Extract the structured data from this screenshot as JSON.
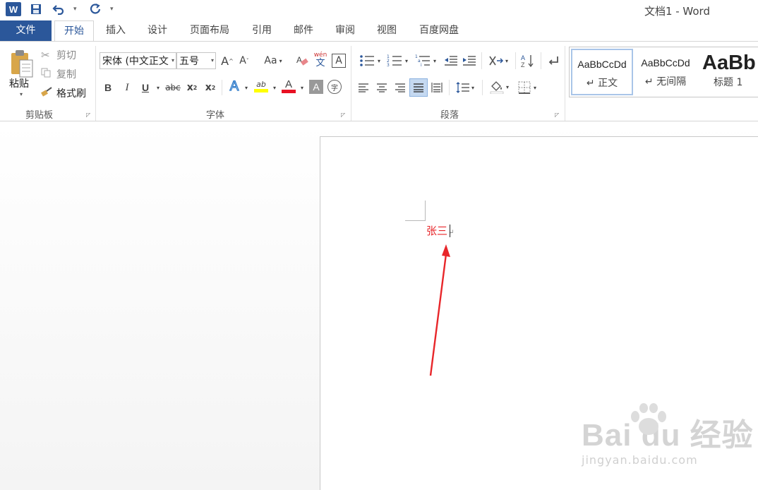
{
  "window": {
    "title": "文档1 - Word"
  },
  "qat": {
    "logo_letter": "W",
    "save_icon": "save-icon",
    "undo_icon": "undo-icon",
    "redo_icon": "redo-icon",
    "customize_icon": "customize-qat-icon"
  },
  "tabs": [
    {
      "label": "文件"
    },
    {
      "label": "开始"
    },
    {
      "label": "插入"
    },
    {
      "label": "设计"
    },
    {
      "label": "页面布局"
    },
    {
      "label": "引用"
    },
    {
      "label": "邮件"
    },
    {
      "label": "审阅"
    },
    {
      "label": "视图"
    },
    {
      "label": "百度网盘"
    }
  ],
  "clipboard": {
    "group_label": "剪贴板",
    "paste_label": "粘贴",
    "cut_label": "剪切",
    "copy_label": "复制",
    "format_painter_label": "格式刷"
  },
  "font": {
    "group_label": "字体",
    "font_name": "宋体 (中文正文",
    "font_size": "五号",
    "grow_label": "A",
    "shrink_label": "A",
    "case_label": "Aa",
    "phonetic_label": "wén",
    "phonetic_char": "文",
    "border_label": "A",
    "bold": "B",
    "italic": "I",
    "underline": "U",
    "strike": "abc",
    "sub_label": "x",
    "sub_mark": "2",
    "sup_label": "x",
    "sup_mark": "2",
    "effects": "A",
    "highlight": "ab",
    "font_color": "A",
    "shading": "A",
    "enclose": "字",
    "highlight_color": "#ffff00",
    "font_color_value": "#e81123"
  },
  "paragraph": {
    "group_label": "段落"
  },
  "styles": {
    "items": [
      {
        "sample": "AaBbCcDd",
        "name": "↵ 正文"
      },
      {
        "sample": "AaBbCcDd",
        "name": "↵ 无间隔"
      },
      {
        "sample": "AaBb",
        "name": "标题 1"
      }
    ]
  },
  "document": {
    "text": "张三",
    "paragraph_mark": "↵",
    "text_color": "#e8262a"
  },
  "watermark": {
    "main": "Bai du 经验",
    "sub": "jingyan.baidu.com"
  }
}
